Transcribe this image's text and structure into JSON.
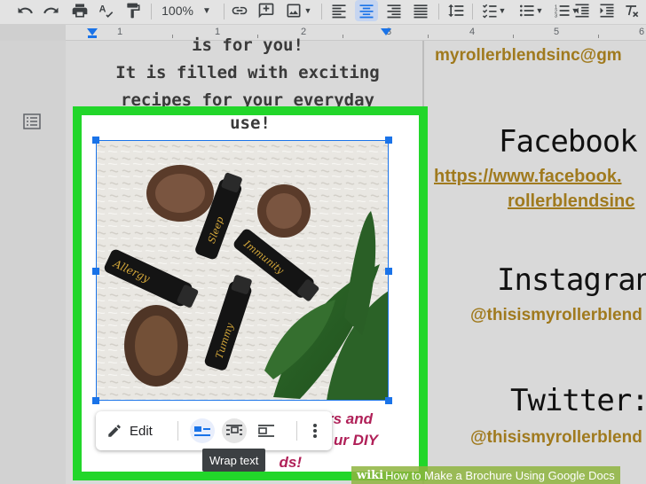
{
  "toolbar": {
    "zoom": "100%",
    "buttons": [
      "undo-icon",
      "redo-icon",
      "print-icon",
      "spellcheck-icon",
      "paint-format-icon",
      "link-icon",
      "add-comment-icon",
      "insert-image-icon",
      "align-left-icon",
      "align-center-icon",
      "align-right-icon",
      "justify-icon",
      "line-spacing-icon",
      "checklist-icon",
      "bulleted-list-icon",
      "numbered-list-icon",
      "decrease-indent-icon",
      "increase-indent-icon"
    ]
  },
  "ruler": {
    "numbers": [
      "1",
      "1",
      "2",
      "3",
      "4",
      "5",
      "6"
    ]
  },
  "document": {
    "line1": "is for you!",
    "line2": "It is filled with exciting",
    "line3": "recipes for your everyday",
    "line4": "use!",
    "caption": {
      "l1": "rs and",
      "l2": "ur DIY",
      "l3": "ds!"
    }
  },
  "image_toolbar": {
    "edit_label": "Edit",
    "tooltip": "Wrap text"
  },
  "right_column": {
    "email": "myrollerblendsinc@gm",
    "facebook_heading": "Facebook",
    "facebook_link_1": "https://www.facebook.",
    "facebook_link_2": "rollerblendsinc",
    "instagram_heading": "Instagran",
    "instagram_handle": "@thisismyrollerblend",
    "twitter_heading": "Twitter:",
    "twitter_handle": "@thisismyrollerblend"
  },
  "watermark": {
    "brand": "wiki",
    "text": "How to Make a Brochure Using Google Docs"
  },
  "colors": {
    "highlight": "#22d62a",
    "link": "#a07a1e",
    "caption": "#b02058",
    "selection": "#1a73e8"
  }
}
